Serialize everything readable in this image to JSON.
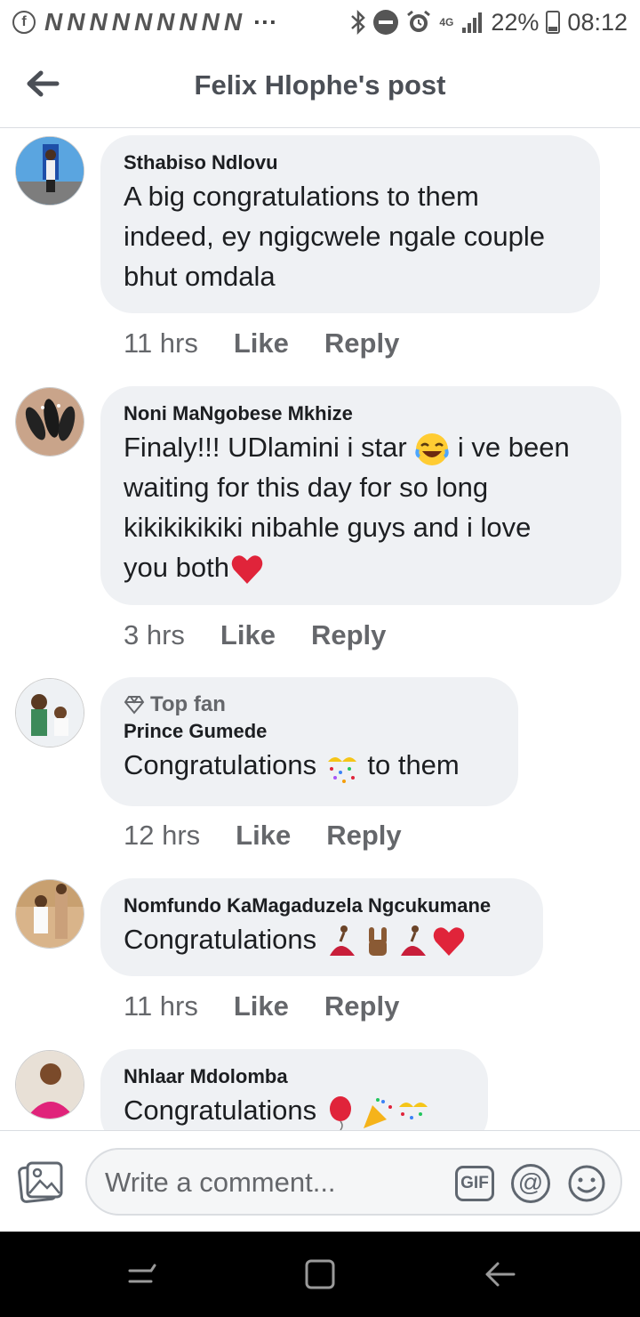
{
  "status_bar": {
    "notification_letters": [
      "N",
      "N",
      "N",
      "N",
      "N",
      "N",
      "N",
      "N",
      "N"
    ],
    "more": "···",
    "network": "4G",
    "battery": "22%",
    "time": "08:12"
  },
  "header": {
    "title": "Felix Hlophe's post"
  },
  "comments": [
    {
      "author": "Sthabiso Ndlovu",
      "lines": [
        "A big congratulations to them",
        "indeed, ey ngigcwele ngale couple",
        "bhut omdala"
      ],
      "time": "11 hrs",
      "like": "Like",
      "reply": "Reply"
    },
    {
      "author": "Noni MaNgobese Mkhize",
      "line1_before": "Finaly!!! UDlamini i star ",
      "line1_after": " i ve been",
      "lines": [
        "waiting for this day for so long",
        "kikikikikiki nibahle guys and i love"
      ],
      "line_last": "you both",
      "time": "3 hrs",
      "like": "Like",
      "reply": "Reply"
    },
    {
      "badge": "Top fan",
      "author": "Prince Gumede",
      "text_before": "Congratulations ",
      "text_after": " to them",
      "time": "12 hrs",
      "like": "Like",
      "reply": "Reply"
    },
    {
      "author": "Nomfundo KaMagaduzela Ngcukumane",
      "text": "Congratulations ",
      "time": "11 hrs",
      "like": "Like",
      "reply": "Reply"
    },
    {
      "author": "Nhlaar Mdolomba",
      "text": "Congratulations "
    }
  ],
  "composer": {
    "placeholder": "Write a comment...",
    "gif_label": "GIF",
    "at_label": "@"
  },
  "colors": {
    "bubble": "#eff1f4",
    "meta_text": "#65676b",
    "heart": "#e0243a"
  }
}
